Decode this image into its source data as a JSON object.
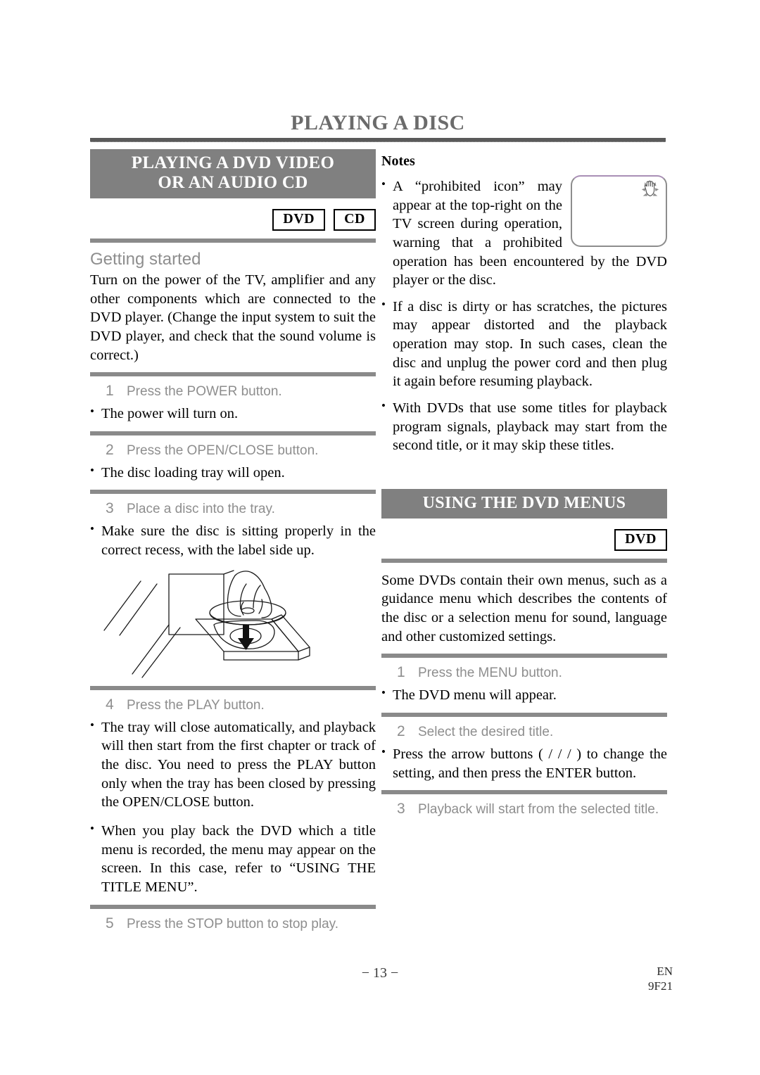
{
  "page": {
    "title": "PLAYING A DISC",
    "page_number": "− 13 −",
    "footer_lang": "EN",
    "footer_code": "9F21",
    "banner_bg": "#808080",
    "rule_color": "#8a8a8a",
    "step_text_color": "#8e8e8e"
  },
  "left": {
    "banner_line1": "PLAYING A DVD VIDEO",
    "banner_line2": "OR AN AUDIO CD",
    "badges": [
      "DVD",
      "CD"
    ],
    "getting_started_heading": "Getting started",
    "intro": "Turn on the power of the TV, amplifier and any other components which are connected to the DVD player. (Change the input system to suit the DVD player, and check that the sound volume is correct.)",
    "steps": [
      {
        "num": "1",
        "text": "Press the POWER button.",
        "bullets": [
          "The power will turn on."
        ]
      },
      {
        "num": "2",
        "text": "Press the OPEN/CLOSE button.",
        "bullets": [
          "The disc loading tray will open."
        ]
      },
      {
        "num": "3",
        "text": "Place a disc into the tray.",
        "bullets": [
          "Make sure the disc is sitting properly in the correct recess, with the label side up."
        ]
      },
      {
        "num": "4",
        "text": "Press the PLAY button.",
        "bullets": [
          "The tray will close automatically, and playback will then start from the first chapter or track of the disc. You need to press the PLAY button only when the tray has been closed by pressing the OPEN/CLOSE button.",
          "When you play back the DVD which a title menu is recorded, the menu may appear on the screen. In this case, refer to “USING THE TITLE MENU”."
        ]
      },
      {
        "num": "5",
        "text": "Press the STOP button to stop play.",
        "bullets": []
      }
    ],
    "figure_caption": "disc-loading-tray-illustration"
  },
  "right": {
    "notes_heading": "Notes",
    "notes": [
      "A “prohibited icon” may appear at the top-right on the TV screen during operation, warning that a prohibited operation has been encountered by the DVD player or the disc.",
      "If a disc is dirty or has scratches, the pictures may appear distorted and the playback operation may stop. In such cases, clean the disc and unplug the power cord and then plug it again before resuming playback.",
      "With DVDs that use some titles for playback program signals, playback may start from the second title, or it may skip these titles."
    ],
    "tv_icon_name": "prohibited-hand-icon",
    "banner": "USING THE DVD MENUS",
    "badges": [
      "DVD"
    ],
    "intro": "Some DVDs contain their own menus, such as a guidance menu which describes the contents of the disc or a selection menu for sound, language and other customized settings.",
    "steps": [
      {
        "num": "1",
        "text": "Press the MENU button.",
        "bullets": [
          "The DVD menu will appear."
        ]
      },
      {
        "num": "2",
        "text": "Select the desired title.",
        "bullets": [
          "Press the arrow buttons (  /  /  /  ) to change the setting, and then press the ENTER button."
        ]
      },
      {
        "num": "3",
        "text": "Playback will start from the selected title.",
        "bullets": []
      }
    ]
  }
}
